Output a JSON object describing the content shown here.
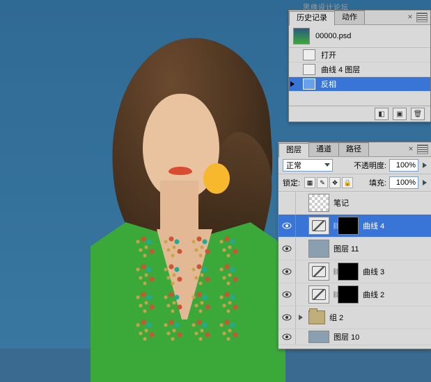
{
  "watermark": "思缘设计论坛   WWW.MISSYUAN.COM",
  "history": {
    "tabs": {
      "history": "历史记录",
      "actions": "动作"
    },
    "close": "×",
    "doc": "00000.psd",
    "items": [
      {
        "label": "打开"
      },
      {
        "label": "曲线 4 图层"
      },
      {
        "label": "反相"
      }
    ]
  },
  "layers": {
    "tabs": {
      "layers": "图层",
      "channels": "通道",
      "paths": "路径"
    },
    "close": "×",
    "blend_label": "",
    "blend_mode": "正常",
    "opacity_label": "不透明度:",
    "opacity_value": "100%",
    "lock_label": "锁定:",
    "fill_label": "填充:",
    "fill_value": "100%",
    "items": [
      {
        "name": "笔记",
        "type": "image",
        "visible": false
      },
      {
        "name": "曲线 4",
        "type": "adjustment",
        "visible": true,
        "mask": true,
        "selected": true
      },
      {
        "name": "图层 11",
        "type": "image",
        "visible": true
      },
      {
        "name": "曲线 3",
        "type": "adjustment",
        "visible": true,
        "mask": true
      },
      {
        "name": "曲线 2",
        "type": "adjustment",
        "visible": true,
        "mask": true
      },
      {
        "name": "组 2",
        "type": "group",
        "visible": true
      },
      {
        "name": "图层 10",
        "type": "image",
        "visible": true
      }
    ]
  }
}
